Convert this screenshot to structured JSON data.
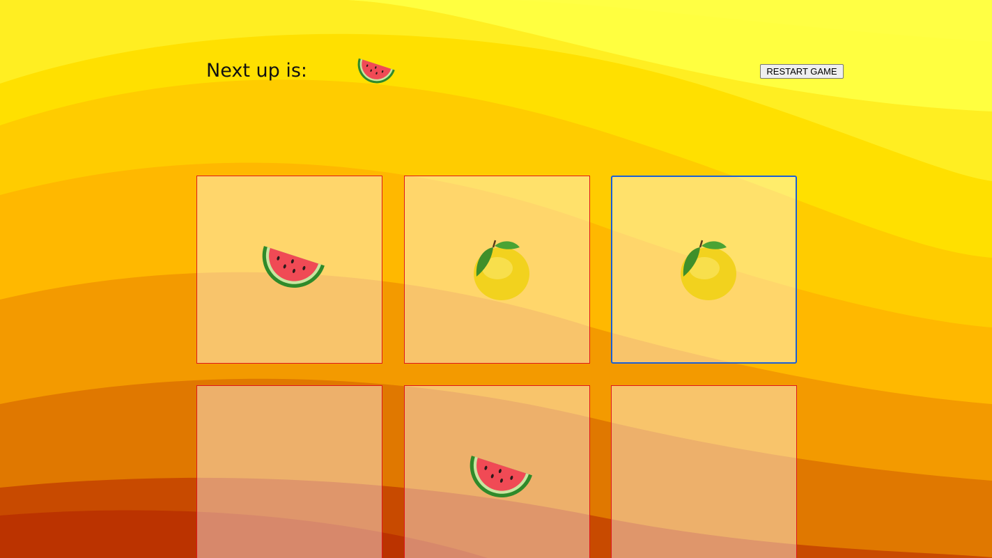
{
  "header": {
    "label": "Next up is:",
    "next_piece_icon": "watermelon-icon"
  },
  "controls": {
    "restart_label": "RESTART GAME"
  },
  "board": {
    "cells": [
      {
        "piece": "watermelon-icon"
      },
      {
        "piece": "lemon-icon"
      },
      {
        "piece": "lemon-icon"
      },
      {
        "piece": ""
      },
      {
        "piece": "watermelon-icon"
      },
      {
        "piece": ""
      }
    ]
  },
  "colors": {
    "cell_border": "#e0161b",
    "focus_border": "#1a5fd6",
    "bg_top": "#ffff4a",
    "bg_bottom": "#bb3300"
  }
}
